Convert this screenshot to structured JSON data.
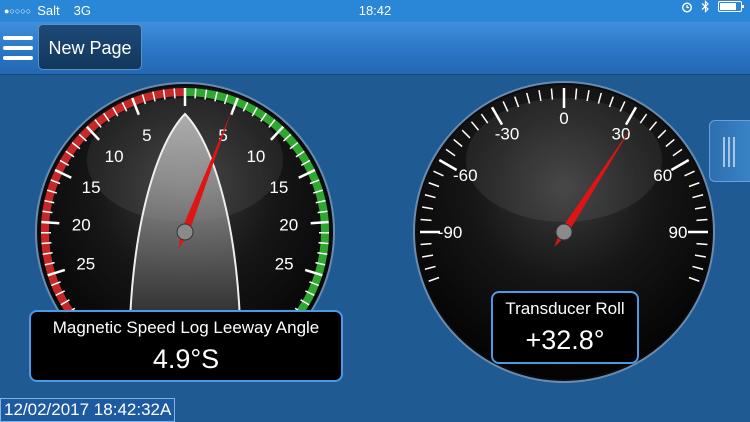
{
  "status_bar": {
    "carrier": "Salt",
    "network": "3G",
    "time": "18:42"
  },
  "toolbar": {
    "page_button_label": "New Page"
  },
  "gauges": {
    "leeway": {
      "title": "Magnetic Speed Log Leeway Angle",
      "value": "4.9°S",
      "needle_value": 4.9,
      "scale_labels": [
        "5",
        "10",
        "15",
        "20",
        "25",
        "5",
        "10",
        "15",
        "20",
        "25"
      ],
      "red_color": "#c62828",
      "green_color": "#2ea82e"
    },
    "roll": {
      "title": "Transducer Roll",
      "value": "+32.8°",
      "needle_value": 32.8,
      "scale_labels": [
        "0",
        "-30",
        "30",
        "-60",
        "60",
        "-90",
        "90"
      ]
    }
  },
  "footer": {
    "timestamp": "12/02/2017 18:42:32A"
  },
  "icons": {
    "signal": "signal-dots-icon",
    "alarm": "alarm-clock-icon",
    "bluetooth": "bluetooth-icon",
    "battery": "battery-icon",
    "menu": "hamburger-menu-icon",
    "side_tab": "drawer-handle-icon"
  },
  "colors": {
    "status_bar": "#2a86d6",
    "background": "#1f5a93",
    "needle": "#e01414",
    "readout_border": "#4a9ae6"
  }
}
